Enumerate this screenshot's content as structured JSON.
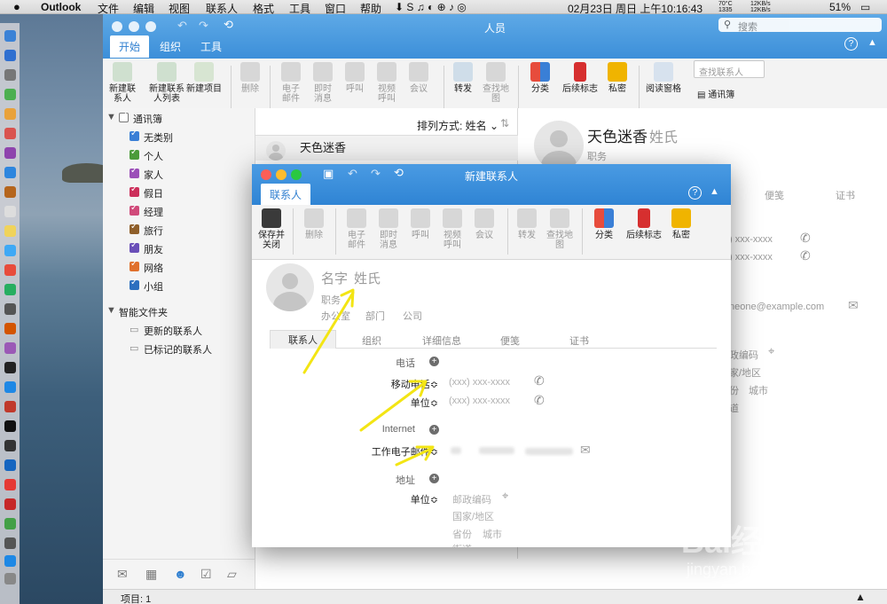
{
  "menubar": {
    "app": "Outlook",
    "items": [
      "文件",
      "编辑",
      "视图",
      "联系人",
      "格式",
      "工具",
      "窗口",
      "帮助"
    ],
    "date": "02月23日 周日 上午10:16:43",
    "battery": "51%",
    "temp": "70°C",
    "rpm": "1335",
    "net_up": "12KB/s",
    "net_down": "12KB/s"
  },
  "main": {
    "title": "人员",
    "search_placeholder": "搜索",
    "tabs": [
      "开始",
      "组织",
      "工具"
    ],
    "ribbon": {
      "new_contact": "新建联系人",
      "new_list": "新建联系人列表",
      "new_item": "新建项目",
      "delete": "删除",
      "email": "电子邮件",
      "im": "即时消息",
      "call": "呼叫",
      "video": "视频呼叫",
      "meeting": "会议",
      "forward": "转发",
      "map": "查找地图",
      "categorize": "分类",
      "followup": "后续标志",
      "private": "私密",
      "reading_pane": "阅读窗格",
      "find_placeholder": "查找联系人",
      "address_book": "通讯簿"
    },
    "folders": {
      "root": "通讯簿",
      "items": [
        {
          "label": "无类别",
          "color": "#3a7fd6"
        },
        {
          "label": "个人",
          "color": "#4b9b3a"
        },
        {
          "label": "家人",
          "color": "#9b4fb8"
        },
        {
          "label": "假日",
          "color": "#cc2f5b"
        },
        {
          "label": "经理",
          "color": "#d04a7a"
        },
        {
          "label": "旅行",
          "color": "#8f5f2a"
        },
        {
          "label": "朋友",
          "color": "#6a4fb8"
        },
        {
          "label": "网络",
          "color": "#e0702c"
        },
        {
          "label": "小组",
          "color": "#2e6fbf"
        }
      ],
      "smart_root": "智能文件夹",
      "smart": [
        "更新的联系人",
        "已标记的联系人"
      ]
    },
    "list": {
      "sort": "排列方式: 姓名",
      "contact": "天色迷香"
    },
    "reading": {
      "first": "天色迷香",
      "last": "姓氏",
      "job": "职务",
      "tab_notes": "便笺",
      "tab_cert": "证书",
      "phone1": ") xxx-xxxx",
      "phone2": ") xxx-xxxx",
      "email": "neone@example.com",
      "postal": "政编码",
      "country": "家/地区",
      "prov": "份",
      "city": "城市",
      "street": "道"
    },
    "status": "项目: 1"
  },
  "dialog": {
    "title": "新建联系人",
    "tab": "联系人",
    "ribbon": {
      "save": "保存并关闭",
      "delete": "删除",
      "email": "电子邮件",
      "im": "即时消息",
      "call": "呼叫",
      "video": "视频呼叫",
      "meeting": "会议",
      "forward": "转发",
      "map": "查找地图",
      "categorize": "分类",
      "followup": "后续标志",
      "private": "私密"
    },
    "name_first": "名字",
    "name_last": "姓氏",
    "job": "职务",
    "office": "办公室",
    "dept": "部门",
    "company": "公司",
    "tabs": [
      "联系人",
      "组织",
      "详细信息",
      "便笺",
      "证书"
    ],
    "phone_header": "电话",
    "mobile_label": "移动电话≎",
    "mobile_ph": "(xxx) xxx-xxxx",
    "work_label": "单位≎",
    "work_ph": "(xxx) xxx-xxxx",
    "internet_header": "Internet",
    "email_label": "工作电子邮件≎",
    "address_header": "地址",
    "addr_label": "单位≎",
    "postal": "邮政编码",
    "country": "国家/地区",
    "prov": "省份",
    "city": "城市",
    "street": "街道"
  },
  "watermark": {
    "brand": "Bai经验",
    "domain": "jingyan.baidu.com"
  }
}
